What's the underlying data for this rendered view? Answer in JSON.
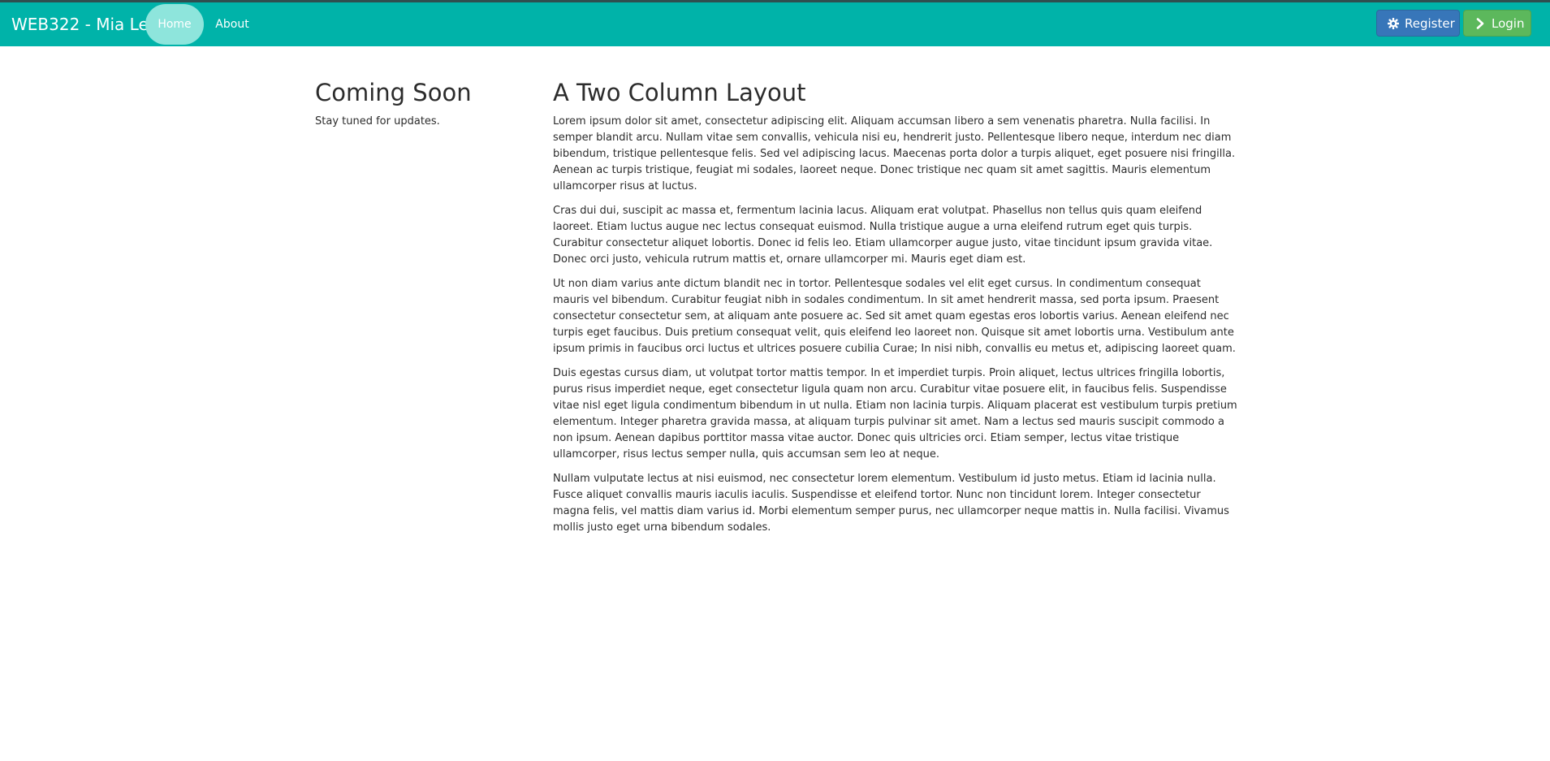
{
  "navbar": {
    "brand": "WEB322 - Mia Le",
    "links": [
      {
        "label": "Home",
        "active": true
      },
      {
        "label": "About",
        "active": false
      }
    ],
    "register": {
      "label": "Register",
      "icon": "gear-icon",
      "color": "#3776b9"
    },
    "login": {
      "label": "Login",
      "icon": "chevron-right-icon",
      "color": "#5cb85c"
    },
    "background": "#00b3a9"
  },
  "sidebar": {
    "title": "Coming Soon",
    "text": "Stay tuned for updates."
  },
  "main": {
    "title": "A Two Column Layout",
    "paragraphs": [
      "Lorem ipsum dolor sit amet, consectetur adipiscing elit. Aliquam accumsan libero a sem venenatis pharetra. Nulla facilisi. In semper blandit arcu. Nullam vitae sem convallis, vehicula nisi eu, hendrerit justo. Pellentesque libero neque, interdum nec diam bibendum, tristique pellentesque felis. Sed vel adipiscing lacus. Maecenas porta dolor a turpis aliquet, eget posuere nisi fringilla. Aenean ac turpis tristique, feugiat mi sodales, laoreet neque. Donec tristique nec quam sit amet sagittis. Mauris elementum ullamcorper risus at luctus.",
      "Cras dui dui, suscipit ac massa et, fermentum lacinia lacus. Aliquam erat volutpat. Phasellus non tellus quis quam eleifend laoreet. Etiam luctus augue nec lectus consequat euismod. Nulla tristique augue a urna eleifend rutrum eget quis turpis. Curabitur consectetur aliquet lobortis. Donec id felis leo. Etiam ullamcorper augue justo, vitae tincidunt ipsum gravida vitae. Donec orci justo, vehicula rutrum mattis et, ornare ullamcorper mi. Mauris eget diam est.",
      "Ut non diam varius ante dictum blandit nec in tortor. Pellentesque sodales vel elit eget cursus. In condimentum consequat mauris vel bibendum. Curabitur feugiat nibh in sodales condimentum. In sit amet hendrerit massa, sed porta ipsum. Praesent consectetur consectetur sem, at aliquam ante posuere ac. Sed sit amet quam egestas eros lobortis varius. Aenean eleifend nec turpis eget faucibus. Duis pretium consequat velit, quis eleifend leo laoreet non. Quisque sit amet lobortis urna. Vestibulum ante ipsum primis in faucibus orci luctus et ultrices posuere cubilia Curae; In nisi nibh, convallis eu metus et, adipiscing laoreet quam.",
      "Duis egestas cursus diam, ut volutpat tortor mattis tempor. In et imperdiet turpis. Proin aliquet, lectus ultrices fringilla lobortis, purus risus imperdiet neque, eget consectetur ligula quam non arcu. Curabitur vitae posuere elit, in faucibus felis. Suspendisse vitae nisl eget ligula condimentum bibendum in ut nulla. Etiam non lacinia turpis. Aliquam placerat est vestibulum turpis pretium elementum. Integer pharetra gravida massa, at aliquam turpis pulvinar sit amet. Nam a lectus sed mauris suscipit commodo a non ipsum. Aenean dapibus porttitor massa vitae auctor. Donec quis ultricies orci. Etiam semper, lectus vitae tristique ullamcorper, risus lectus semper nulla, quis accumsan sem leo at neque.",
      "Nullam vulputate lectus at nisi euismod, nec consectetur lorem elementum. Vestibulum id justo metus. Etiam id lacinia nulla. Fusce aliquet convallis mauris iaculis iaculis. Suspendisse et eleifend tortor. Nunc non tincidunt lorem. Integer consectetur magna felis, vel mattis diam varius id. Morbi elementum semper purus, nec ullamcorper neque mattis in. Nulla facilisi. Vivamus mollis justo eget urna bibendum sodales."
    ]
  }
}
